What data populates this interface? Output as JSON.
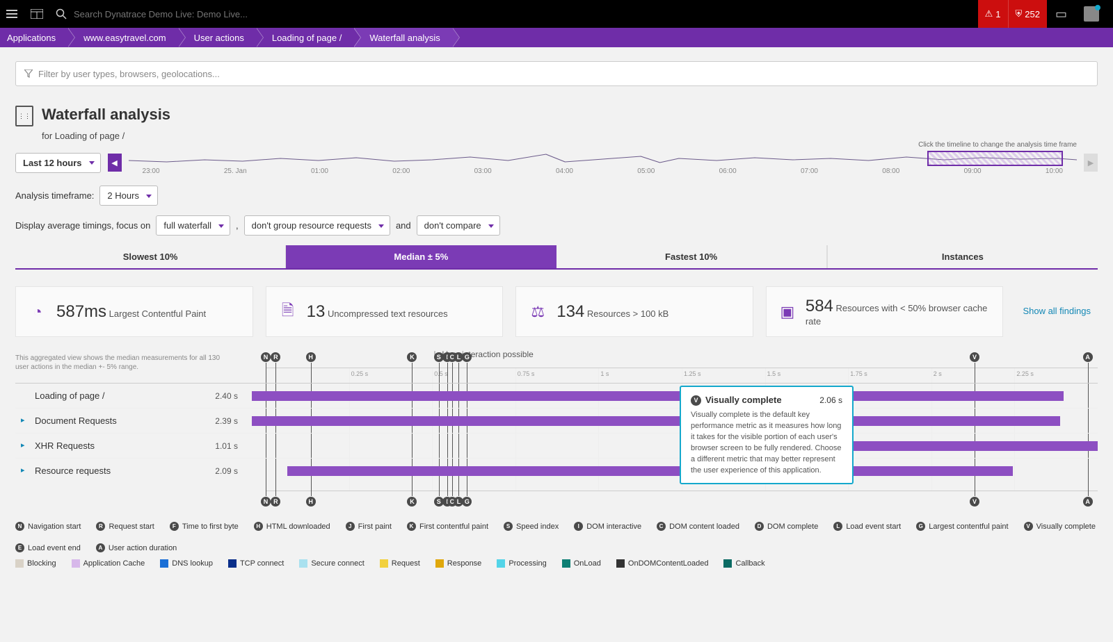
{
  "topbar": {
    "search_placeholder": "Search Dynatrace Demo Live: Demo Live...",
    "alert_count": "1",
    "shield_count": "252"
  },
  "breadcrumb": [
    "Applications",
    "www.easytravel.com",
    "User actions",
    "Loading of page /",
    "Waterfall analysis"
  ],
  "filter_placeholder": "Filter by user types, browsers, geolocations...",
  "page": {
    "title": "Waterfall analysis",
    "subtitle": "for Loading of page /"
  },
  "timeframe_dropdown": "Last 12 hours",
  "timeline_hint": "Click the timeline to change the analysis time frame",
  "timeline_ticks": [
    "23:00",
    "25. Jan",
    "01:00",
    "02:00",
    "03:00",
    "04:00",
    "05:00",
    "06:00",
    "07:00",
    "08:00",
    "09:00",
    "10:00"
  ],
  "analysis_tf_label": "Analysis timeframe:",
  "analysis_tf_value": "2 Hours",
  "display_line": {
    "prefix": "Display average timings, focus on",
    "sel1": "full waterfall",
    "sep1": ",",
    "sel2": "don't group resource requests",
    "sep2": "and",
    "sel3": "don't compare"
  },
  "tabs": [
    "Slowest 10%",
    "Median ± 5%",
    "Fastest 10%",
    "Instances"
  ],
  "active_tab": 1,
  "cards": [
    {
      "value": "587ms",
      "label": "Largest Contentful Paint"
    },
    {
      "value": "13",
      "label": "Uncompressed text resources"
    },
    {
      "value": "134",
      "label": "Resources > 100 kB"
    },
    {
      "value": "584",
      "label": "Resources with < 50% browser cache rate"
    }
  ],
  "show_all": "Show all findings",
  "wf_note": "This aggregated view shows the median measurements for all 130 user actions in the median +- 5% range.",
  "interaction_note": "User interaction possible",
  "chart_data": {
    "type": "waterfall-gantt",
    "xlabel": "seconds",
    "xlim": [
      0,
      2.5
    ],
    "ticks": [
      "0.25 s",
      "0.5 s",
      "0.75 s",
      "1 s",
      "1.25 s",
      "1.5 s",
      "1.75 s",
      "2 s",
      "2.25 s"
    ],
    "markers": [
      {
        "code": "N",
        "label": "Navigation start",
        "t": 0.0
      },
      {
        "code": "R",
        "label": "Request start",
        "t": 0.03
      },
      {
        "code": "H",
        "label": "HTML downloaded",
        "t": 0.135
      },
      {
        "code": "K",
        "label": "First contentful paint",
        "t": 0.44
      },
      {
        "code": "S",
        "label": "Speed index",
        "t": 0.52
      },
      {
        "code": "I",
        "label": "DOM interactive",
        "t": 0.545
      },
      {
        "code": "C",
        "label": "DOM content loaded",
        "t": 0.56
      },
      {
        "code": "L",
        "label": "Load event start",
        "t": 0.58
      },
      {
        "code": "G",
        "label": "Largest contentful paint",
        "t": 0.605
      },
      {
        "code": "V",
        "label": "Visually complete",
        "t": 2.13
      },
      {
        "code": "A",
        "label": "User action duration",
        "t": 2.47
      }
    ],
    "rows": [
      {
        "name": "Loading of page /",
        "value": "2.40 s",
        "start": 0.0,
        "end": 2.4,
        "expandable": false
      },
      {
        "name": "Document Requests",
        "value": "2.39 s",
        "start": 0.0,
        "end": 2.39,
        "expandable": true
      },
      {
        "name": "XHR Requests",
        "value": "1.01 s",
        "start": 1.5,
        "end": 2.51,
        "expandable": true
      },
      {
        "name": "Resource requests",
        "value": "2.09 s",
        "start": 0.105,
        "end": 2.25,
        "expandable": true
      }
    ]
  },
  "tooltip": {
    "code": "V",
    "title": "Visually complete",
    "value": "2.06 s",
    "body": "Visually complete is the default key performance metric as it measures how long it takes for the visible portion of each user's browser screen to be fully rendered. Choose a different metric that may better represent the user experience of this application."
  },
  "marker_legend": [
    {
      "code": "N",
      "label": "Navigation start"
    },
    {
      "code": "R",
      "label": "Request start"
    },
    {
      "code": "F",
      "label": "Time to first byte"
    },
    {
      "code": "H",
      "label": "HTML downloaded"
    },
    {
      "code": "J",
      "label": "First paint"
    },
    {
      "code": "K",
      "label": "First contentful paint"
    },
    {
      "code": "S",
      "label": "Speed index"
    },
    {
      "code": "I",
      "label": "DOM interactive"
    },
    {
      "code": "C",
      "label": "DOM content loaded"
    },
    {
      "code": "D",
      "label": "DOM complete"
    },
    {
      "code": "L",
      "label": "Load event start"
    },
    {
      "code": "G",
      "label": "Largest contentful paint"
    },
    {
      "code": "V",
      "label": "Visually complete"
    },
    {
      "code": "E",
      "label": "Load event end"
    },
    {
      "code": "A",
      "label": "User action duration"
    }
  ],
  "color_legend": [
    {
      "color": "#d9d2c7",
      "label": "Blocking"
    },
    {
      "color": "#d7b8ea",
      "label": "Application Cache"
    },
    {
      "color": "#1a6fd6",
      "label": "DNS lookup"
    },
    {
      "color": "#0a2f8a",
      "label": "TCP connect"
    },
    {
      "color": "#a9e1ef",
      "label": "Secure connect"
    },
    {
      "color": "#f2d13e",
      "label": "Request"
    },
    {
      "color": "#e0a80c",
      "label": "Response"
    },
    {
      "color": "#53d4e8",
      "label": "Processing"
    },
    {
      "color": "#0e7f74",
      "label": "OnLoad"
    },
    {
      "color": "#333333",
      "label": "OnDOMContentLoaded"
    },
    {
      "color": "#0b6b63",
      "label": "Callback"
    }
  ]
}
